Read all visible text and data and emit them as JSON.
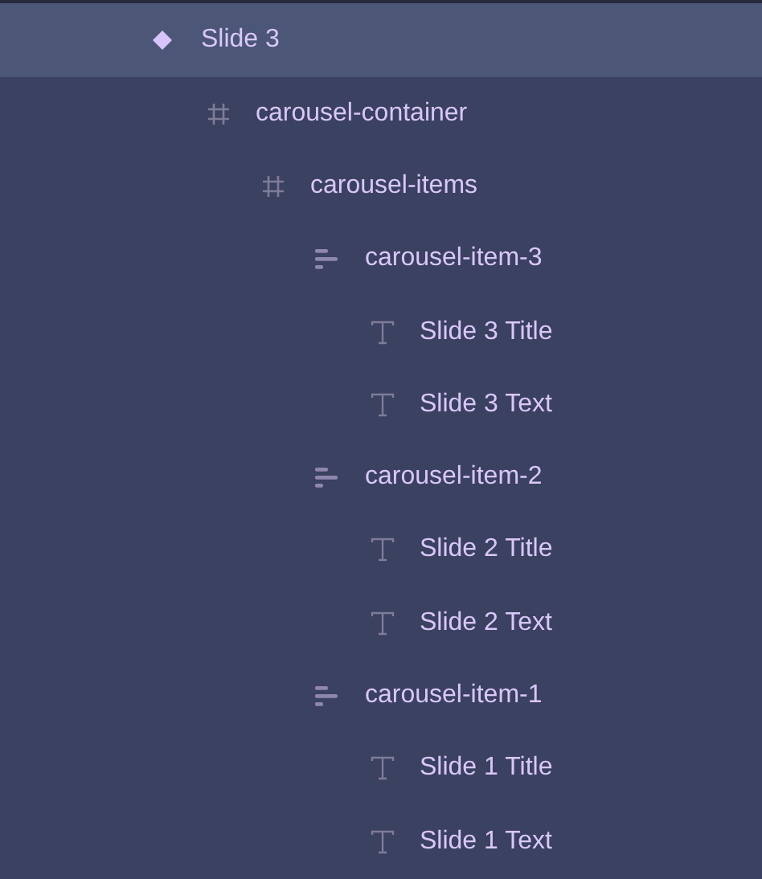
{
  "layers": [
    {
      "name": "Slide 3",
      "kind": "component",
      "selected": true,
      "children": [
        {
          "name": "carousel-container",
          "kind": "frame",
          "selected": false,
          "children": [
            {
              "name": "carousel-items",
              "kind": "frame",
              "selected": false,
              "children": [
                {
                  "name": "carousel-item-3",
                  "kind": "stack",
                  "selected": false,
                  "children": [
                    {
                      "name": "Slide 3 Title",
                      "kind": "text",
                      "selected": false
                    },
                    {
                      "name": "Slide 3 Text",
                      "kind": "text",
                      "selected": false
                    }
                  ]
                },
                {
                  "name": "carousel-item-2",
                  "kind": "stack",
                  "selected": false,
                  "children": [
                    {
                      "name": "Slide 2 Title",
                      "kind": "text",
                      "selected": false
                    },
                    {
                      "name": "Slide 2 Text",
                      "kind": "text",
                      "selected": false
                    }
                  ]
                },
                {
                  "name": "carousel-item-1",
                  "kind": "stack",
                  "selected": false,
                  "children": [
                    {
                      "name": "Slide 1 Title",
                      "kind": "text",
                      "selected": false
                    },
                    {
                      "name": "Slide 1 Text",
                      "kind": "text",
                      "selected": false
                    }
                  ]
                }
              ]
            }
          ]
        }
      ]
    }
  ]
}
